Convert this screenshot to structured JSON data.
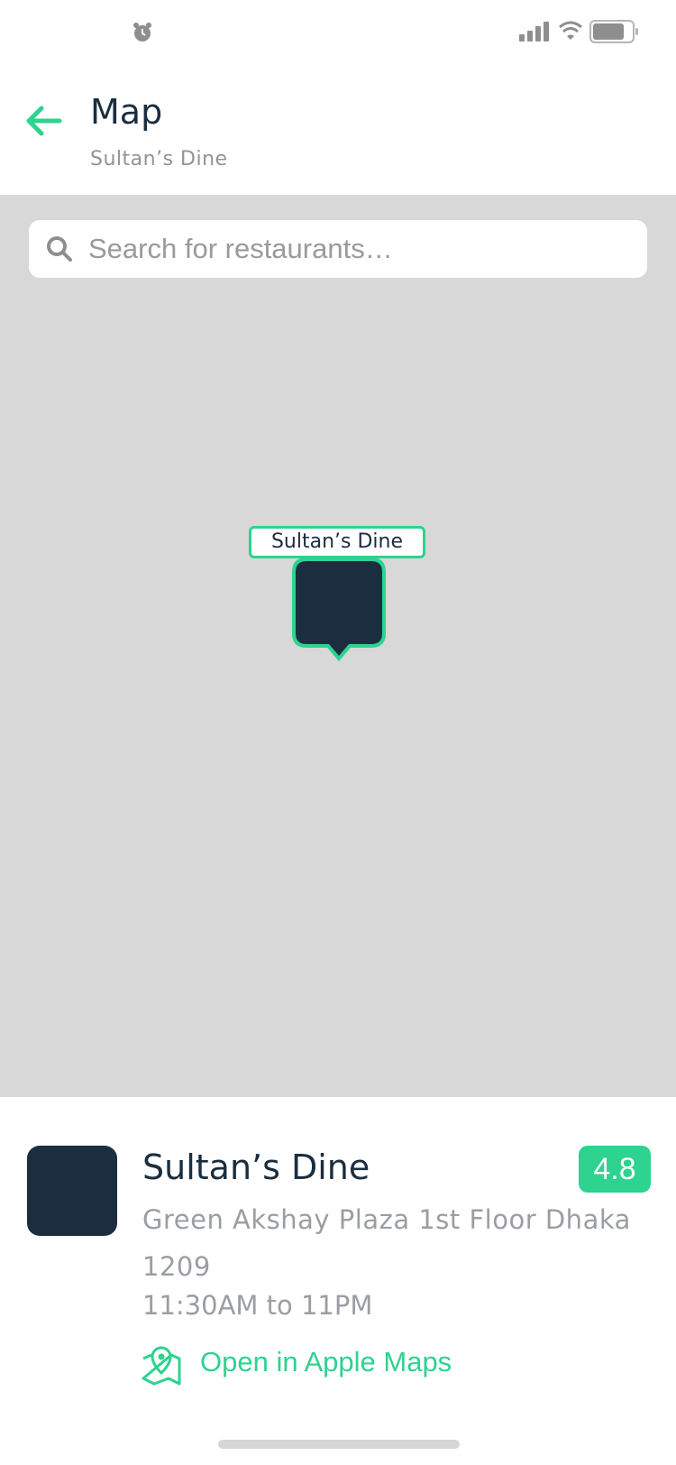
{
  "status_bar": {
    "icons": [
      "alarm-icon",
      "signal-icon",
      "wifi-icon",
      "battery-icon"
    ],
    "battery_level": 0.8
  },
  "header": {
    "title": "Map",
    "subtitle": "Sultan’s Dine",
    "back_icon": "arrow-left-icon"
  },
  "map": {
    "search_placeholder": "Search for restaurants…",
    "search_icon": "search-icon",
    "marker": {
      "label": "Sultan’s Dine"
    }
  },
  "restaurant": {
    "name": "Sultan’s Dine",
    "rating": "4.8",
    "address": "Green Akshay Plaza 1st Floor  Dhaka 1209",
    "hours": "11:30AM to 11PM",
    "open_maps_label": "Open in Apple Maps",
    "open_maps_icon": "map-pin-icon"
  },
  "colors": {
    "accent": "#2dd38f",
    "dark": "#1b2e40",
    "map_bg": "#d8d8d8",
    "muted_text": "#9a9ea3"
  }
}
